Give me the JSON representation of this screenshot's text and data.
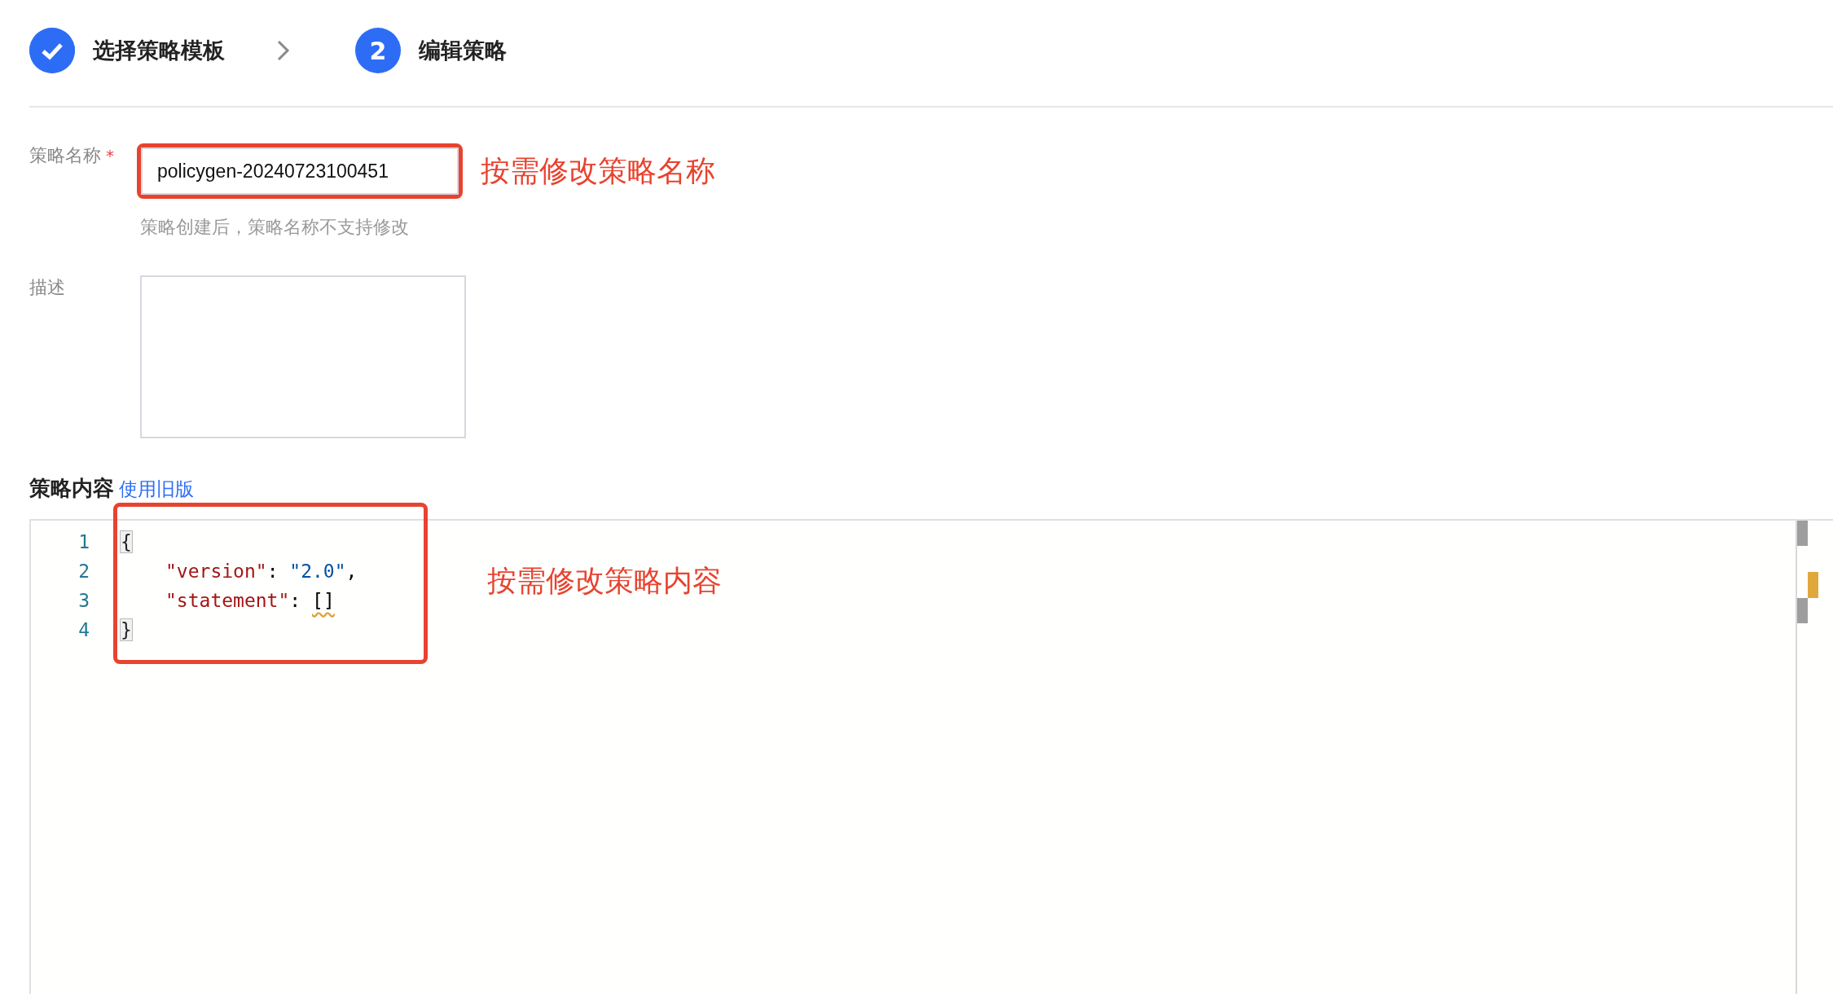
{
  "steps": [
    {
      "label": "选择策略模板",
      "completed": true
    },
    {
      "label": "编辑策略",
      "number": "2",
      "completed": false
    }
  ],
  "form": {
    "name_label": "策略名称",
    "required_mark": "*",
    "name_value": "policygen-20240723100451",
    "name_hint": "策略创建后，策略名称不支持修改",
    "description_label": "描述"
  },
  "annotations": {
    "name_note": "按需修改策略名称",
    "content_note": "按需修改策略内容"
  },
  "content": {
    "title": "策略内容",
    "legacy_link": "使用旧版"
  },
  "editor": {
    "lines": [
      {
        "number": "1",
        "indented": false,
        "tokens": [
          {
            "text": "{",
            "kind": "bracket"
          }
        ]
      },
      {
        "number": "2",
        "indented": true,
        "tokens": [
          {
            "text": "\"version\"",
            "kind": "key"
          },
          {
            "text": ": ",
            "kind": "plain"
          },
          {
            "text": "\"2.0\"",
            "kind": "string"
          },
          {
            "text": ",",
            "kind": "plain"
          }
        ]
      },
      {
        "number": "3",
        "indented": true,
        "tokens": [
          {
            "text": "\"statement\"",
            "kind": "key"
          },
          {
            "text": ": ",
            "kind": "plain"
          },
          {
            "text": "[]",
            "kind": "warning"
          }
        ]
      },
      {
        "number": "4",
        "indented": false,
        "tokens": [
          {
            "text": "}",
            "kind": "bracket"
          }
        ]
      }
    ]
  }
}
